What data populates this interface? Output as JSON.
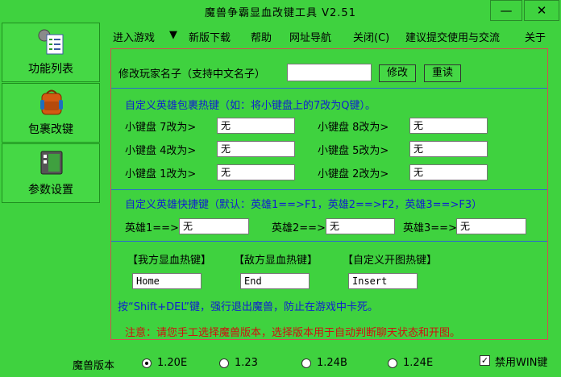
{
  "window": {
    "title": "魔兽争霸显血改键工具  V2.51",
    "minimize": "—",
    "close": "✕"
  },
  "sidebar": {
    "items": [
      {
        "label": "功能列表",
        "icon": "checklist-icon"
      },
      {
        "label": "包裹改键",
        "icon": "backpack-icon"
      },
      {
        "label": "参数设置",
        "icon": "settings-window-icon"
      }
    ]
  },
  "menu": [
    "进入游戏",
    "▼",
    "新版下载",
    "帮助",
    "网址导航",
    "关闭(C)",
    "建议提交使用与交流",
    "关于"
  ],
  "rename": {
    "label": "修改玩家名子（支持中文名子）",
    "value": "",
    "modify_btn": "修改",
    "reset_btn": "重读"
  },
  "bag": {
    "heading": "自定义英雄包裹热键（如：将小键盘上的7改为Q键）。",
    "items": [
      {
        "label": "小键盘 7改为>",
        "value": "无"
      },
      {
        "label": "小键盘 8改为>",
        "value": "无"
      },
      {
        "label": "小键盘 4改为>",
        "value": "无"
      },
      {
        "label": "小键盘 5改为>",
        "value": "无"
      },
      {
        "label": "小键盘 1改为>",
        "value": "无"
      },
      {
        "label": "小键盘 2改为>",
        "value": "无"
      }
    ]
  },
  "hero": {
    "heading": "自定义英雄快捷键（默认：英雄1==>F1，英雄2==>F2，英雄3==>F3）",
    "items": [
      {
        "label": "英雄1==>",
        "value": "无"
      },
      {
        "label": "英雄2==>",
        "value": "无"
      },
      {
        "label": "英雄3==>",
        "value": "无"
      }
    ]
  },
  "hotkeys": {
    "labels": [
      "【我方显血热键】",
      "【敌方显血热键】",
      "【自定义开图热键】"
    ],
    "values": [
      "Home",
      "End",
      "Insert"
    ],
    "exit_tip": "按“Shift+DEL”键，强行退出魔兽，防止在游戏中卡死。",
    "notice": "注意：请您手工选择魔兽版本，选择版本用于自动判断聊天状态和开图。"
  },
  "version": {
    "label": "魔兽版本",
    "options": [
      "1.20E",
      "1.23",
      "1.24B",
      "1.24E"
    ],
    "selected": "1.20E"
  },
  "disable_win": {
    "label": "禁用WIN键",
    "checked": true
  }
}
